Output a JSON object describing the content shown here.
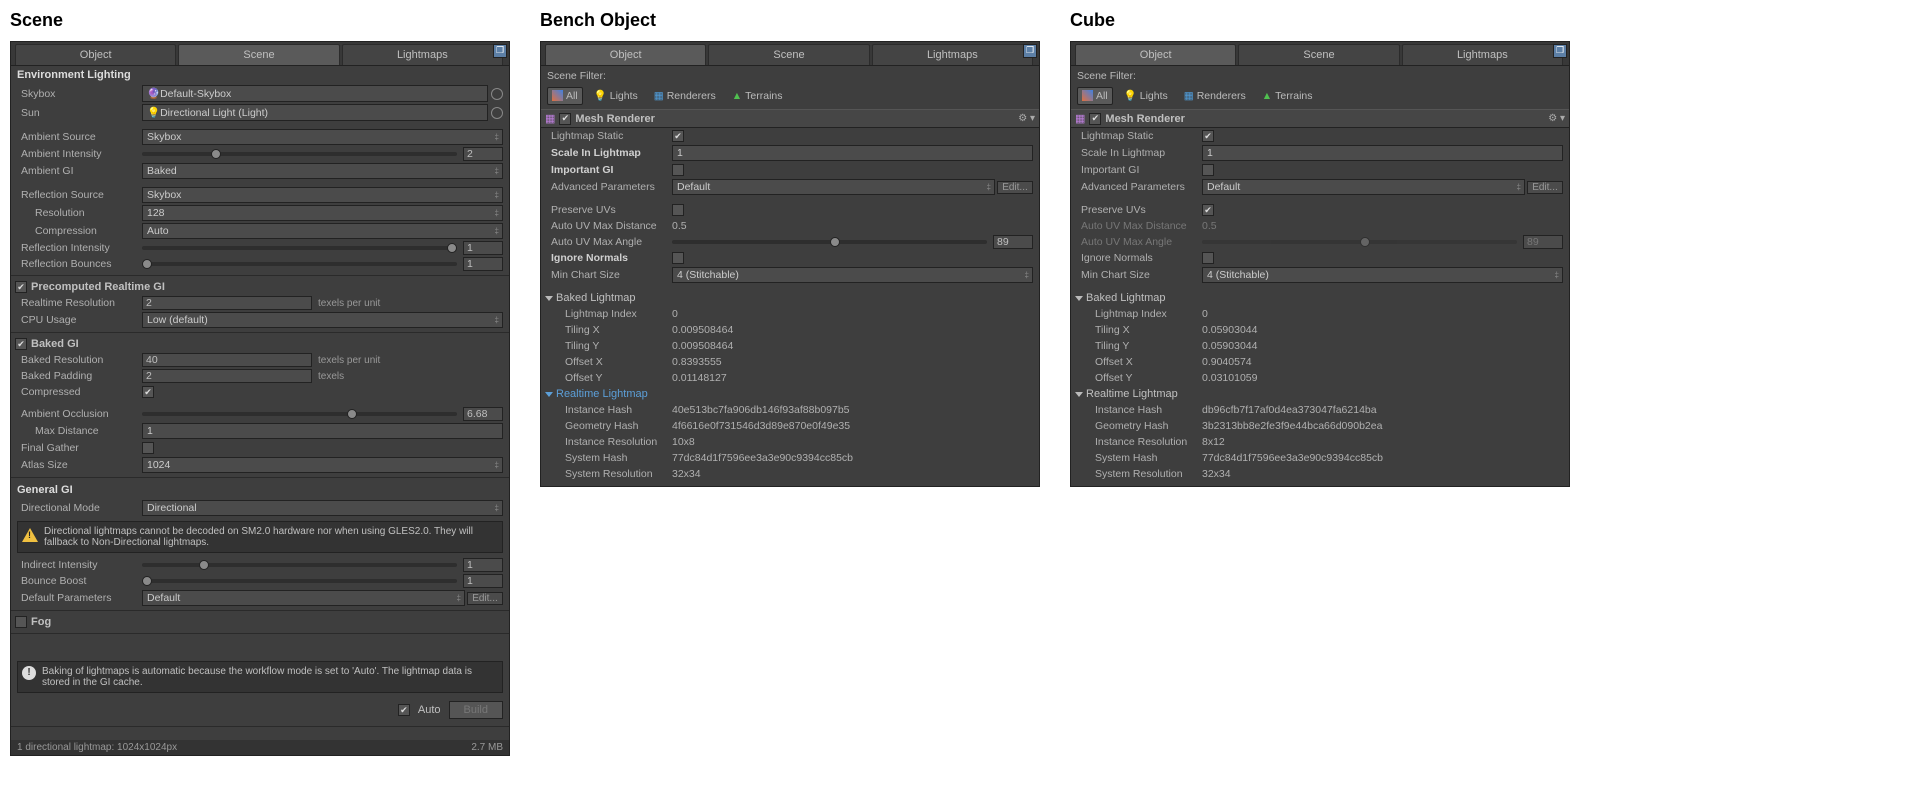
{
  "titles": {
    "scene": "Scene",
    "bench": "Bench Object",
    "cube": "Cube"
  },
  "tabs": {
    "object": "Object",
    "scene": "Scene",
    "lightmaps": "Lightmaps"
  },
  "scene": {
    "env_heading": "Environment Lighting",
    "skybox_label": "Skybox",
    "skybox_value": "Default-Skybox",
    "sun_label": "Sun",
    "sun_value": "Directional Light (Light)",
    "ambient_source_label": "Ambient Source",
    "ambient_source_value": "Skybox",
    "ambient_intensity_label": "Ambient Intensity",
    "ambient_intensity_value": "2",
    "ambient_gi_label": "Ambient GI",
    "ambient_gi_value": "Baked",
    "reflection_source_label": "Reflection Source",
    "reflection_source_value": "Skybox",
    "resolution_label": "Resolution",
    "resolution_value": "128",
    "compression_label": "Compression",
    "compression_value": "Auto",
    "reflection_intensity_label": "Reflection Intensity",
    "reflection_intensity_value": "1",
    "reflection_bounces_label": "Reflection Bounces",
    "reflection_bounces_value": "1",
    "precomputed_label": "Precomputed Realtime GI",
    "realtime_res_label": "Realtime Resolution",
    "realtime_res_value": "2",
    "texels_unit": "texels per unit",
    "cpu_usage_label": "CPU Usage",
    "cpu_usage_value": "Low (default)",
    "baked_gi_label": "Baked GI",
    "baked_res_label": "Baked Resolution",
    "baked_res_value": "40",
    "baked_padding_label": "Baked Padding",
    "baked_padding_value": "2",
    "texels": "texels",
    "compressed_label": "Compressed",
    "ao_label": "Ambient Occlusion",
    "ao_value": "6.68",
    "max_distance_label": "Max Distance",
    "max_distance_value": "1",
    "final_gather_label": "Final Gather",
    "atlas_size_label": "Atlas Size",
    "atlas_size_value": "1024",
    "general_gi_label": "General GI",
    "directional_mode_label": "Directional Mode",
    "directional_mode_value": "Directional",
    "warn_text": "Directional lightmaps cannot be decoded on SM2.0 hardware nor when using GLES2.0. They will fallback to Non-Directional lightmaps.",
    "indirect_intensity_label": "Indirect Intensity",
    "indirect_intensity_value": "1",
    "bounce_boost_label": "Bounce Boost",
    "bounce_boost_value": "1",
    "default_params_label": "Default Parameters",
    "default_params_value": "Default",
    "edit_btn": "Edit...",
    "fog_label": "Fog",
    "info_text": "Baking of lightmaps is automatic because the workflow mode is set to 'Auto'. The lightmap data is stored in the GI cache.",
    "auto_label": "Auto",
    "build_btn": "Build",
    "footer_left": "1 directional lightmap: 1024x1024px",
    "footer_right": "2.7 MB"
  },
  "filter": {
    "label": "Scene Filter:",
    "all": "All",
    "lights": "Lights",
    "renderers": "Renderers",
    "terrains": "Terrains"
  },
  "mesh": {
    "title": "Mesh Renderer",
    "lightmap_static": "Lightmap Static",
    "scale_in_lightmap": "Scale In Lightmap",
    "scale_value": "1",
    "important_gi": "Important GI",
    "advanced_params": "Advanced Parameters",
    "advanced_value": "Default",
    "edit_btn": "Edit...",
    "preserve_uvs": "Preserve UVs",
    "auto_uv_dist": "Auto UV Max Distance",
    "auto_uv_dist_value": "0.5",
    "auto_uv_angle": "Auto UV Max Angle",
    "auto_uv_angle_value": "89",
    "ignore_normals": "Ignore Normals",
    "min_chart": "Min Chart Size",
    "min_chart_value": "4 (Stitchable)",
    "baked_lightmap": "Baked Lightmap",
    "lightmap_index": "Lightmap Index",
    "tiling_x": "Tiling X",
    "tiling_y": "Tiling Y",
    "offset_x": "Offset X",
    "offset_y": "Offset Y",
    "realtime_lightmap": "Realtime Lightmap",
    "instance_hash": "Instance Hash",
    "geometry_hash": "Geometry Hash",
    "instance_res": "Instance Resolution",
    "system_hash": "System Hash",
    "system_res": "System Resolution"
  },
  "bench": {
    "lightmap_index": "0",
    "tiling_x": "0.009508464",
    "tiling_y": "0.009508464",
    "offset_x": "0.8393555",
    "offset_y": "0.01148127",
    "instance_hash": "40e513bc7fa906db146f93af88b097b5",
    "geometry_hash": "4f6616e0f731546d3d89e870e0f49e35",
    "instance_res": "10x8",
    "system_hash": "77dc84d1f7596ee3a3e90c9394cc85cb",
    "system_res": "32x34",
    "preserve_uvs_checked": false
  },
  "cube": {
    "lightmap_index": "0",
    "tiling_x": "0.05903044",
    "tiling_y": "0.05903044",
    "offset_x": "0.9040574",
    "offset_y": "0.03101059",
    "instance_hash": "db96cfb7f17af0d4ea373047fa6214ba",
    "geometry_hash": "3b2313bb8e2fe3f9e44bca66d090b2ea",
    "instance_res": "8x12",
    "system_hash": "77dc84d1f7596ee3a3e90c9394cc85cb",
    "system_res": "32x34",
    "preserve_uvs_checked": true
  }
}
